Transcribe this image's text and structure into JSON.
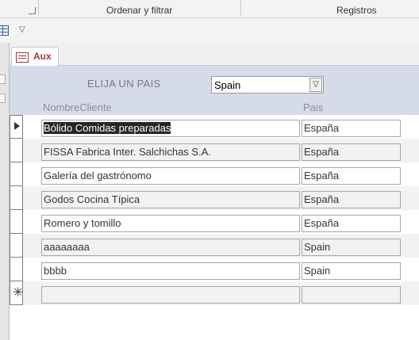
{
  "ribbon": {
    "groups": [
      "Ordenar y filtrar",
      "Registros"
    ]
  },
  "qat": {
    "icons": [
      "table-icon",
      "customize-dropdown-icon"
    ],
    "customize_glyph": "▽"
  },
  "tab": {
    "label": "Aux",
    "icon": "form-icon"
  },
  "form": {
    "country_label": "ELIJA UN PAIS",
    "country_combo_value": "Spain",
    "combo_button_glyph": "▽",
    "columns": [
      "NombreCliente",
      "Pais"
    ],
    "rows": [
      {
        "name": "Bólido Comidas preparadas",
        "pais": "España",
        "current": true,
        "selected": true
      },
      {
        "name": "FISSA Fabrica Inter. Salchichas S.A.",
        "pais": "España"
      },
      {
        "name": "Galería del gastrónomo",
        "pais": "España"
      },
      {
        "name": "Godos Cocina Típica",
        "pais": "España"
      },
      {
        "name": "Romero y tomillo",
        "pais": "España"
      },
      {
        "name": "aaaaaaaa",
        "pais": "Spain"
      },
      {
        "name": "bbbb",
        "pais": "Spain"
      },
      {
        "name": "",
        "pais": "",
        "new_record": true
      }
    ],
    "new_record_glyph": "✳"
  }
}
